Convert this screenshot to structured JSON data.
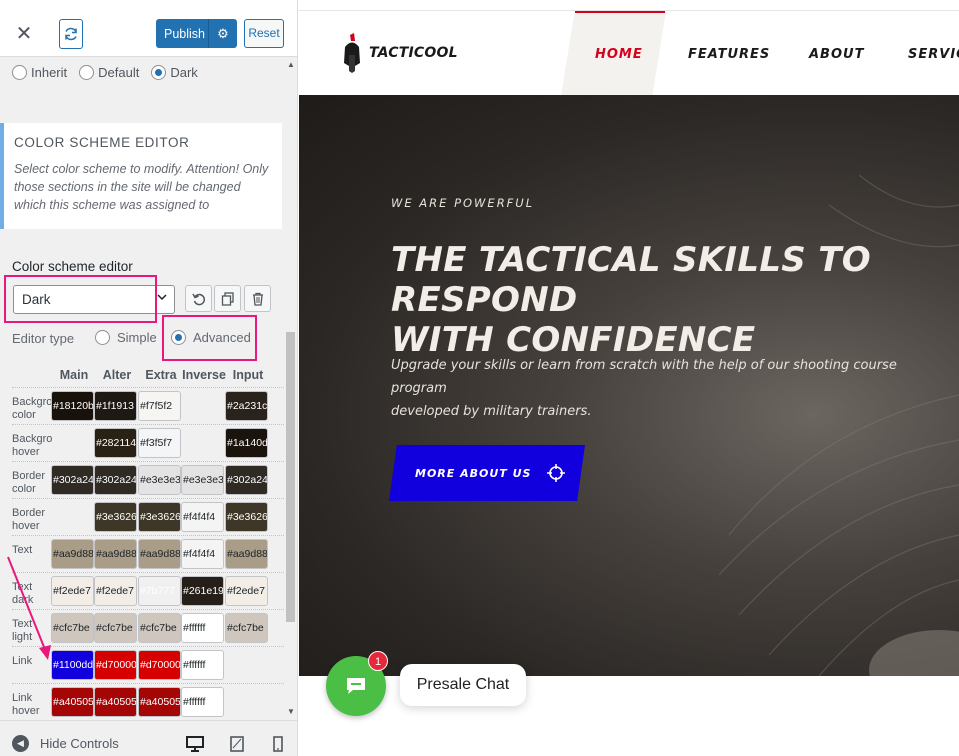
{
  "panel": {
    "publish_label": "Publish",
    "reset_label": "Reset",
    "scheme_radio": [
      {
        "label": "Inherit",
        "checked": false
      },
      {
        "label": "Default",
        "checked": false
      },
      {
        "label": "Dark",
        "checked": true
      }
    ],
    "cse_title": "COLOR SCHEME EDITOR",
    "cse_description": "Select color scheme to modify. Attention! Only those sections in the site will be changed which this scheme was assigned to",
    "editor_label": "Color scheme editor",
    "selected_scheme": "Dark",
    "editor_type_label": "Editor type",
    "editor_type_simple": "Simple",
    "editor_type_advanced": "Advanced",
    "editor_type_selected": "Advanced",
    "grid_headers": [
      "Main",
      "Alter",
      "Extra",
      "Inverse",
      "Input"
    ],
    "grid_rows": [
      {
        "label": "Background color",
        "cells": [
          "#18120b",
          "#1f1913",
          "#f7f5f2",
          null,
          "#2a231c"
        ]
      },
      {
        "label": "Background hover",
        "cells": [
          null,
          "#282114",
          "#f3f5f7",
          null,
          "#1a140d"
        ]
      },
      {
        "label": "Border color",
        "cells": [
          "#302a24",
          "#302a24",
          "#e3e3e3",
          "#e3e3e3",
          "#302a24"
        ]
      },
      {
        "label": "Border hover",
        "cells": [
          null,
          "#3e3626",
          "#3e3626",
          "#f4f4f4",
          "#3e3626"
        ]
      },
      {
        "label": "Text",
        "cells": [
          "#aa9d88",
          "#aa9d88",
          "#aa9d88",
          "#f4f4f4",
          "#aa9d88"
        ]
      },
      {
        "label": "Text dark",
        "cells": [
          "#f2ede7",
          "#f2ede7",
          "#7b777",
          "#261e19",
          "#f2ede7"
        ]
      },
      {
        "label": "Text light",
        "cells": [
          "#cfc7be",
          "#cfc7be",
          "#cfc7be",
          "#ffffff",
          "#cfc7be"
        ]
      },
      {
        "label": "Link",
        "cells": [
          "#1100dd",
          "#d70000",
          "#d70000",
          "#ffffff",
          null
        ]
      },
      {
        "label": "Link hover",
        "cells": [
          "#a40505",
          "#a40505",
          "#a40505",
          "#ffffff",
          null
        ]
      }
    ],
    "hide_controls_label": "Hide Controls"
  },
  "site": {
    "logo_text": "TACTICOOL",
    "nav": [
      "HOME",
      "FEATURES",
      "ABOUT",
      "SERVICES"
    ],
    "nav_active": "HOME",
    "hero_pre": "WE ARE POWERFUL",
    "hero_title_line1": "THE TACTICAL SKILLS TO RESPOND",
    "hero_title_line2": "WITH CONFIDENCE",
    "hero_sub_line1": "Upgrade your skills or learn from scratch with the help of our shooting course program",
    "hero_sub_line2": "developed by military trainers.",
    "hero_button": "MORE ABOUT US"
  },
  "chat": {
    "badge_count": "1",
    "label": "Presale Chat"
  },
  "colors": {
    "wp_blue": "#2271b1",
    "highlight_pink": "#e8187d",
    "brand_red": "#d5001c",
    "button_blue": "#1100dd",
    "chat_green": "#4bbe46"
  },
  "icons": [
    "close-icon",
    "refresh-icon",
    "gear-icon",
    "chevron-down-icon",
    "undo-icon",
    "copy-icon",
    "trash-icon",
    "collapse-icon",
    "desktop-icon",
    "tablet-icon",
    "mobile-icon",
    "crosshair-icon",
    "chat-icon",
    "helmet-logo-icon"
  ]
}
